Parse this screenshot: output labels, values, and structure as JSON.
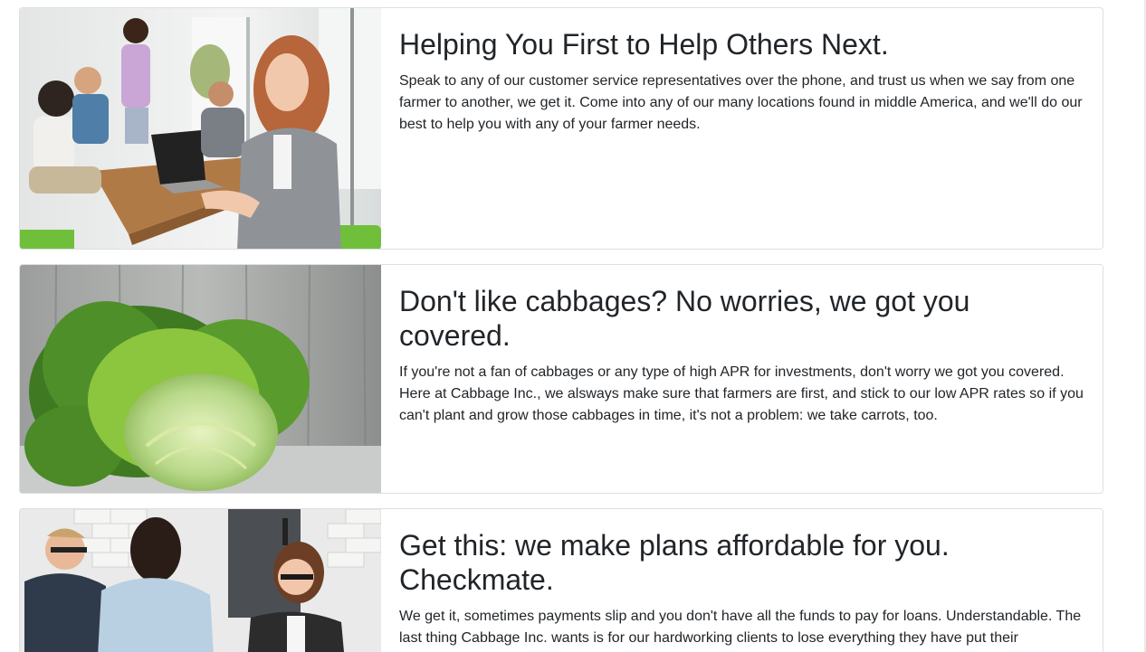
{
  "cards": [
    {
      "title": "Helping You First to Help Others Next.",
      "text": "Speak to any of our customer service representatives over the phone, and trust us when we say from one farmer to another, we get it. Come into any of our many locations found in middle America, and we'll do our best to help you with any of your farmer needs.",
      "image_icon": "team-meeting-photo"
    },
    {
      "title": "Don't like cabbages? No worries, we got you covered.",
      "text": "If you're not a fan of cabbages or any type of high APR for investments, don't worry we got you covered. Here at Cabbage Inc., we alsways make sure that farmers are first, and stick to our low APR rates so if you can't plant and grow those cabbages in time, it's not a problem: we take carrots, too.",
      "image_icon": "cabbage-photo"
    },
    {
      "title": "Get this: we make plans affordable for you. Checkmate.",
      "text": "We get it, sometimes payments slip and you don't have all the funds to pay for loans. Understandable. The last thing Cabbage Inc. wants is for our hardworking clients to lose everything they have put their",
      "image_icon": "handshake-photo"
    }
  ],
  "colors": {
    "text": "#212529",
    "border": "#dfdfdf",
    "cabbage_green": "#7cb342"
  }
}
